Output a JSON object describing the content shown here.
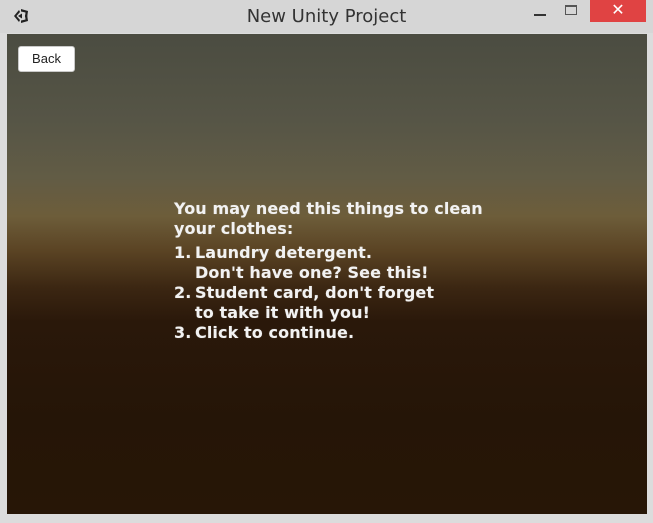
{
  "window": {
    "title": "New Unity Project",
    "close_glyph": "✕"
  },
  "game": {
    "back_label": "Back",
    "intro": [
      "You may need this things to clean",
      "your clothes:"
    ],
    "items": [
      {
        "number": "1.",
        "lines": [
          "Laundry detergent.",
          "Don't have one? See this!"
        ]
      },
      {
        "number": "2.",
        "lines": [
          "Student card, don't forget",
          "to take it with you!"
        ]
      },
      {
        "number": "3.",
        "lines": [
          "Click to continue."
        ]
      }
    ]
  },
  "icons": {
    "app": "unity-logo-icon",
    "minimize": "minimize-icon",
    "maximize": "maximize-icon",
    "close": "close-icon"
  },
  "colors": {
    "close_button": "#e04343",
    "text": "#f2f2f2"
  }
}
